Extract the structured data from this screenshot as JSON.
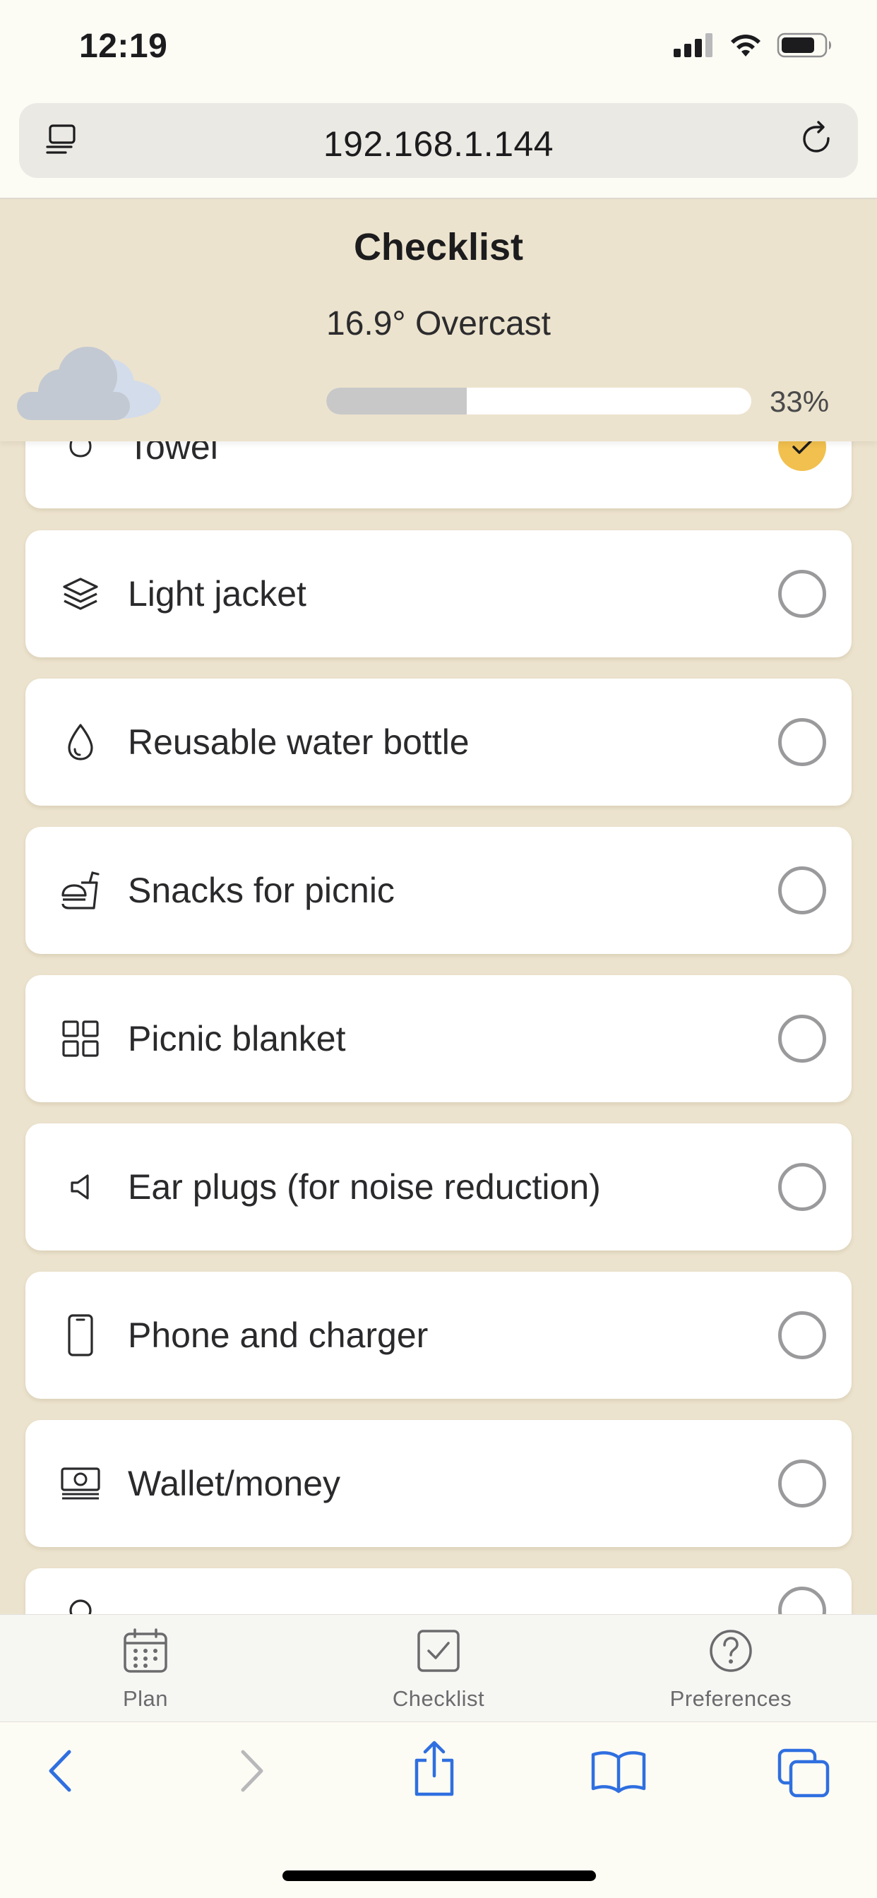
{
  "status_bar": {
    "time": "12:19"
  },
  "browser": {
    "url": "192.168.1.144"
  },
  "header": {
    "title": "Checklist",
    "weather": "16.9° Overcast",
    "weather_icon": "cloud-icon",
    "progress_percent": 33,
    "progress_label": "33%"
  },
  "checklist": {
    "items": [
      {
        "label": "Towel",
        "icon": "towel-icon",
        "checked": true
      },
      {
        "label": "Light jacket",
        "icon": "layers-icon",
        "checked": false
      },
      {
        "label": "Reusable water bottle",
        "icon": "water-drop-icon",
        "checked": false
      },
      {
        "label": "Snacks for picnic",
        "icon": "fast-food-icon",
        "checked": false
      },
      {
        "label": "Picnic blanket",
        "icon": "grid-icon",
        "checked": false
      },
      {
        "label": "Ear plugs (for noise reduction)",
        "icon": "speaker-icon",
        "checked": false
      },
      {
        "label": "Phone and charger",
        "icon": "phone-icon",
        "checked": false
      },
      {
        "label": "Wallet/money",
        "icon": "money-icon",
        "checked": false
      },
      {
        "label": "",
        "icon": "item-icon",
        "checked": false
      }
    ]
  },
  "tab_bar": {
    "tabs": [
      {
        "label": "Plan",
        "icon": "calendar-icon"
      },
      {
        "label": "Checklist",
        "icon": "checkbox-icon",
        "active": true
      },
      {
        "label": "Preferences",
        "icon": "help-icon"
      }
    ]
  },
  "colors": {
    "background": "#ece3ce",
    "accent": "#f1c04e",
    "safari_blue": "#2f6fe0"
  }
}
